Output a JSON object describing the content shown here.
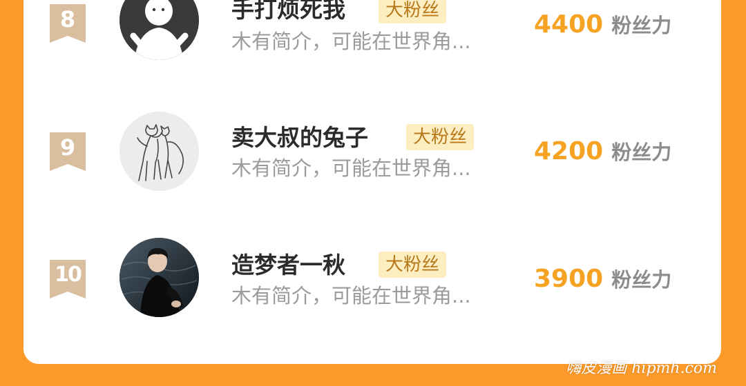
{
  "ranking": {
    "rows": [
      {
        "rank": "8",
        "name": "手打烦死我",
        "tag": "大粉丝",
        "bio": "木有简介，可能在世界角...",
        "score": "4400",
        "score_unit": "粉丝力",
        "avatar_icon": "default-person-avatar-icon"
      },
      {
        "rank": "9",
        "name": "卖大叔的兔子",
        "tag": "大粉丝",
        "bio": "木有简介，可能在世界角...",
        "score": "4200",
        "score_unit": "粉丝力",
        "avatar_icon": "dancing-cats-sketch-avatar-icon"
      },
      {
        "rank": "10",
        "name": "造梦者一秋",
        "tag": "大粉丝",
        "bio": "木有简介，可能在世界角...",
        "score": "3900",
        "score_unit": "粉丝力",
        "avatar_icon": "man-portrait-avatar-icon"
      }
    ]
  },
  "watermark": "嗨皮漫画 hipmh.com",
  "colors": {
    "background": "#fd9a29",
    "card": "#ffffff",
    "score": "#f6a324",
    "tag_bg": "#fdeec2",
    "tag_text": "#b7791a",
    "rank_badge": "#d9bfa0"
  }
}
